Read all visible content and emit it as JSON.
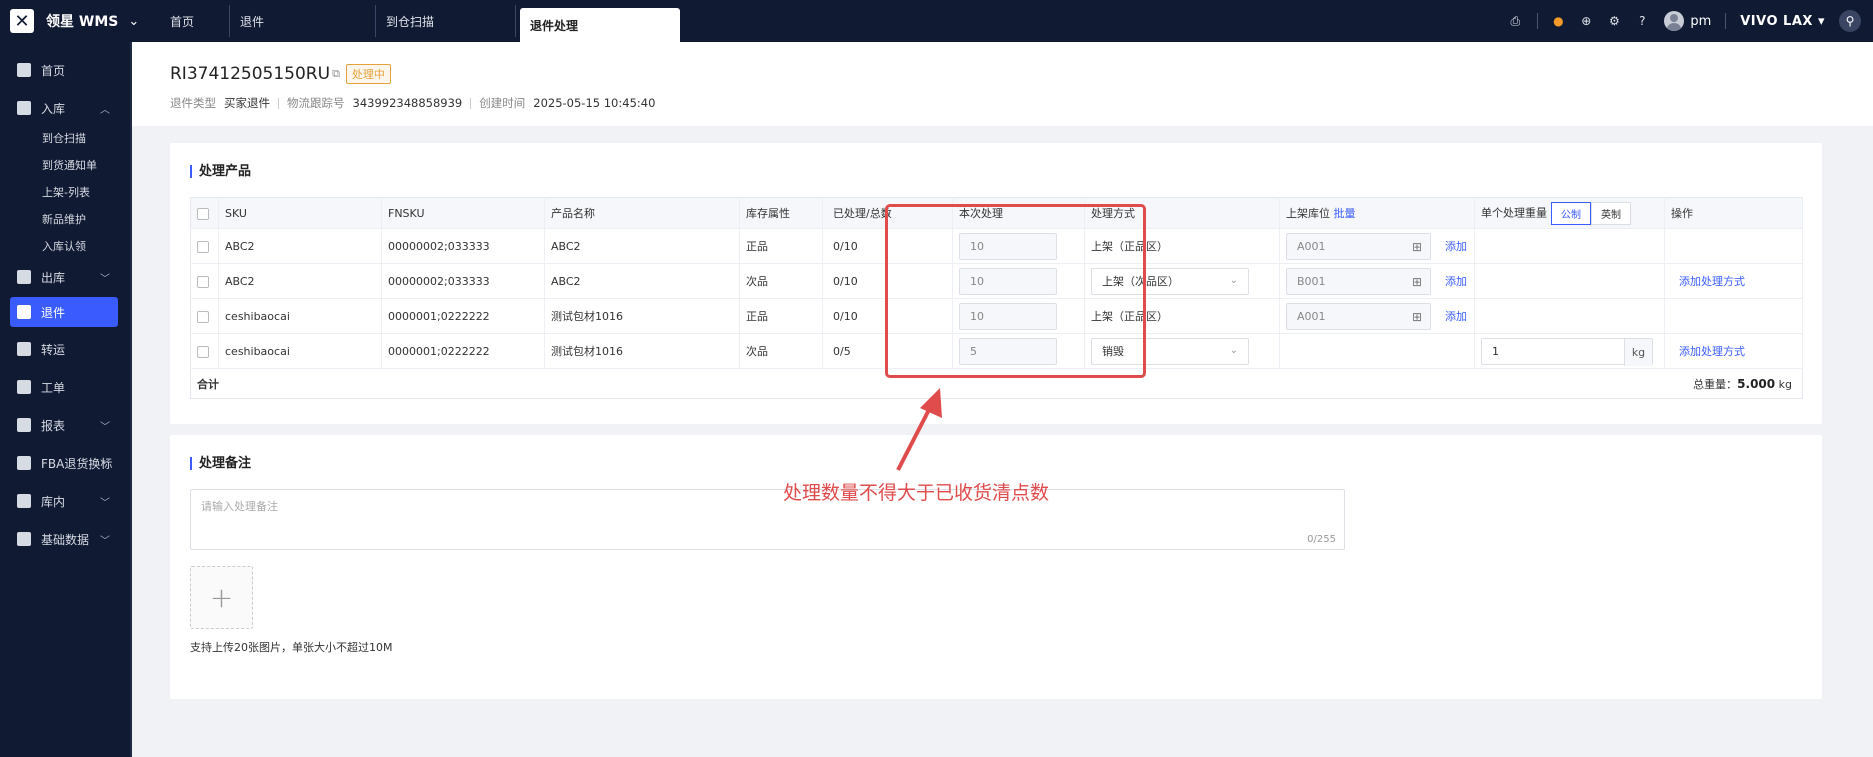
{
  "brand": {
    "name": "领星 WMS"
  },
  "tabs": [
    {
      "label": "首页",
      "active": false
    },
    {
      "label": "退件",
      "active": false
    },
    {
      "label": "到仓扫描",
      "active": false
    },
    {
      "label": "退件处理",
      "active": true
    }
  ],
  "topbar": {
    "user": "pm",
    "warehouse": "VIVO LAX"
  },
  "sidebar": {
    "items": [
      {
        "label": "首页"
      },
      {
        "label": "入库",
        "expanded": true,
        "children": [
          "到仓扫描",
          "到货通知单",
          "上架-列表",
          "新品维护",
          "入库认领"
        ]
      },
      {
        "label": "出库"
      },
      {
        "label": "退件",
        "active": true
      },
      {
        "label": "转运"
      },
      {
        "label": "工单"
      },
      {
        "label": "报表"
      },
      {
        "label": "FBA退货换标"
      },
      {
        "label": "库内"
      },
      {
        "label": "基础数据"
      }
    ]
  },
  "header": {
    "return_id": "RI37412505150RU",
    "status": "处理中",
    "meta": [
      {
        "key": "退件类型",
        "value": "买家退件"
      },
      {
        "key": "物流跟踪号",
        "value": "343992348858939"
      },
      {
        "key": "创建时间",
        "value": "2025-05-15 10:45:40"
      }
    ]
  },
  "products": {
    "title": "处理产品",
    "columns": [
      "SKU",
      "FNSKU",
      "产品名称",
      "库存属性",
      "已处理/总数",
      "本次处理",
      "处理方式",
      "上架库位",
      "单个处理重量",
      "操作"
    ],
    "batch_label": "批量",
    "unit_metric": "公制",
    "unit_imperial": "英制",
    "add_label": "添加",
    "add_method_label": "添加处理方式",
    "rows": [
      {
        "sku": "ABC2",
        "fnsku": "00000002;033333",
        "name": "ABC2",
        "attr": "正品",
        "attr_good": true,
        "progress": "0/10",
        "qty": "10",
        "method": "上架（正品区）",
        "method_select": false,
        "location": "A001",
        "weight": "",
        "action": ""
      },
      {
        "sku": "ABC2",
        "fnsku": "00000002;033333",
        "name": "ABC2",
        "attr": "次品",
        "attr_good": false,
        "progress": "0/10",
        "qty": "10",
        "method": "上架（次品区）",
        "method_select": true,
        "location": "B001",
        "weight": "",
        "action": "添加处理方式"
      },
      {
        "sku": "ceshibaocai",
        "fnsku": "0000001;0222222",
        "name": "测试包材1016",
        "attr": "正品",
        "attr_good": true,
        "progress": "0/10",
        "qty": "10",
        "method": "上架（正品区）",
        "method_select": false,
        "location": "A001",
        "weight": "",
        "action": ""
      },
      {
        "sku": "ceshibaocai",
        "fnsku": "0000001;0222222",
        "name": "测试包材1016",
        "attr": "次品",
        "attr_good": false,
        "progress": "0/5",
        "qty": "5",
        "method": "销毁",
        "method_select": true,
        "location": "",
        "weight": "1",
        "action": "添加处理方式"
      }
    ],
    "total_label": "合计",
    "total_weight_label": "总重量：",
    "total_weight": "5.000",
    "weight_unit": "kg"
  },
  "remark": {
    "title": "处理备注",
    "placeholder": "请输入处理备注",
    "counter": "0/255",
    "upload_tip": "支持上传20张图片，单张大小不超过10M"
  },
  "annotation": {
    "text": "处理数量不得大于已收货清点数",
    "color": "#e04b4b"
  }
}
